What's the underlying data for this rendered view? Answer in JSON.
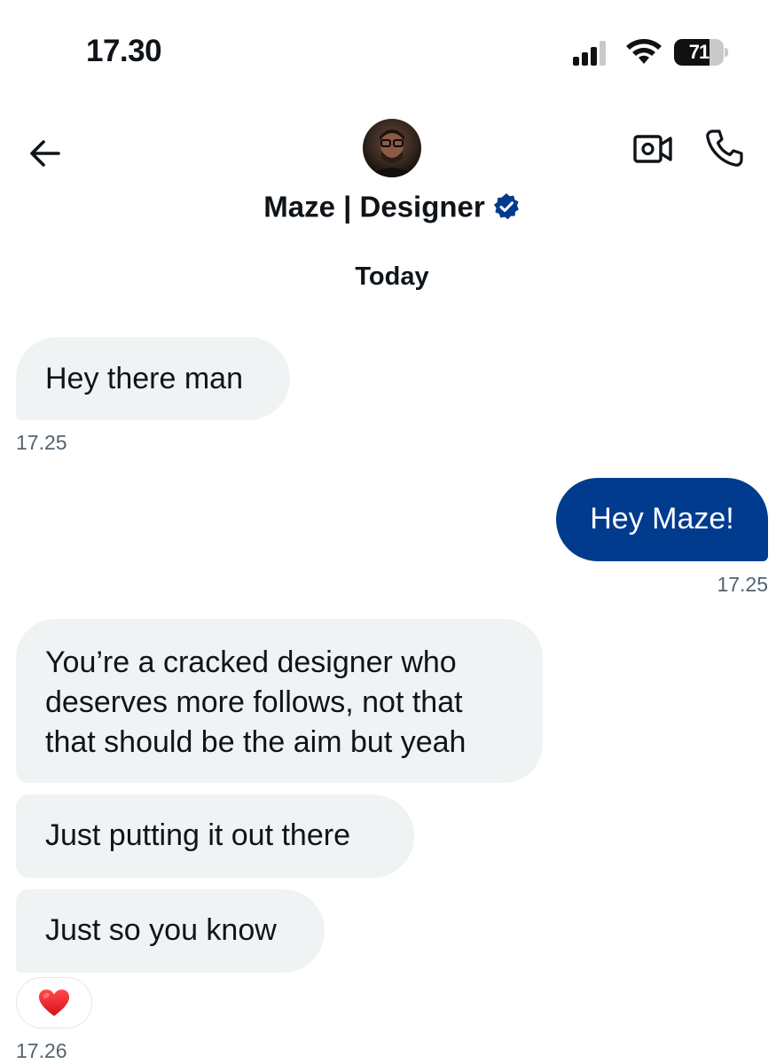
{
  "status_bar": {
    "time": "17.30",
    "battery": "71",
    "battery_level": 0.71
  },
  "header": {
    "contact_name": "Maze | Designer",
    "icons": [
      "back-arrow-icon",
      "avatar",
      "verified-badge-icon",
      "video-camera-icon",
      "phone-icon"
    ],
    "accent_color": "#003b8e"
  },
  "day_divider": "Today",
  "messages": [
    {
      "direction": "in",
      "text": "Hey there man",
      "time": "17.25"
    },
    {
      "direction": "out",
      "text": "Hey Maze!",
      "time": "17.25"
    },
    {
      "direction": "in",
      "lines": [
        "You’re a cracked designer who",
        "deserves more follows, not that",
        "that should be the aim but yeah"
      ]
    },
    {
      "direction": "in",
      "text": "Just putting it out there"
    },
    {
      "direction": "in",
      "text": "Just so you know",
      "reaction": "heart-icon",
      "time": "17.26"
    }
  ],
  "colors": {
    "incoming_bubble": "#eff3f4",
    "outgoing_bubble": "#003b8e",
    "timestamp": "#536471"
  }
}
